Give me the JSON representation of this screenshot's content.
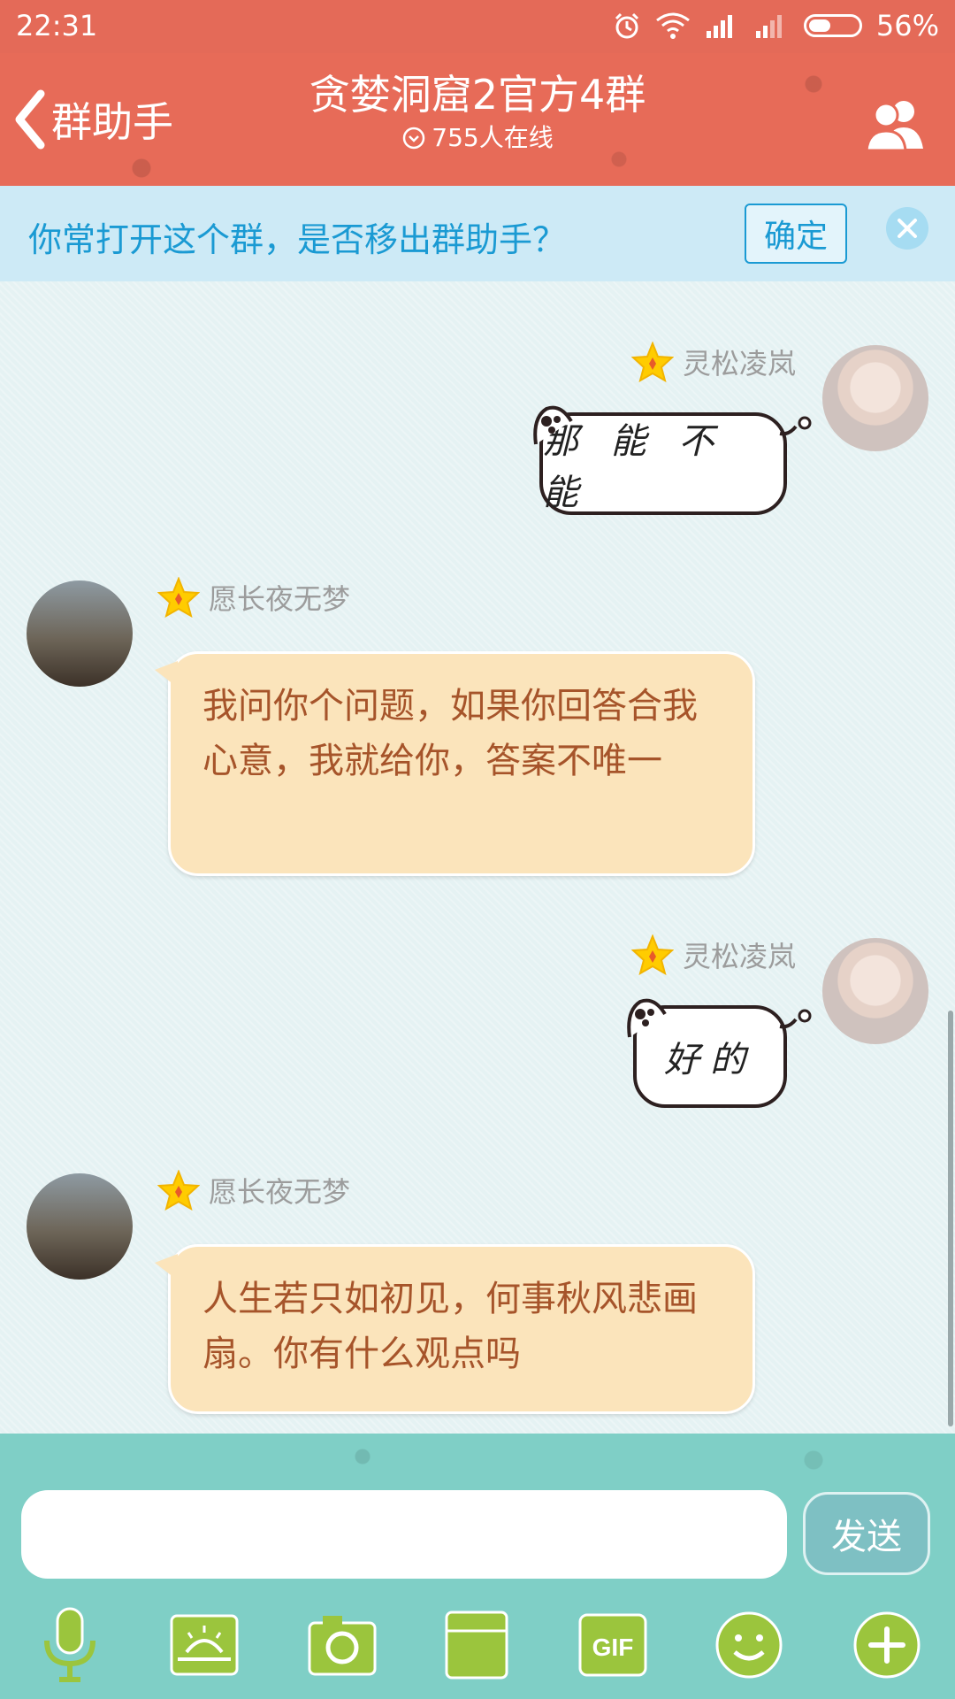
{
  "status_bar": {
    "time": "22:31",
    "battery": "56%"
  },
  "header": {
    "back_label": "群助手",
    "title": "贪婪洞窟2官方4群",
    "online": "755人在线"
  },
  "notice": {
    "text": "你常打开这个群，是否移出群助手？",
    "confirm_label": "确定"
  },
  "messages": [
    {
      "sender": "灵松凌岚",
      "side": "right",
      "type": "ghost",
      "text": "那 能 不 能"
    },
    {
      "sender": "愿长夜无梦",
      "side": "left",
      "type": "text",
      "text": "我问你个问题，如果你回答合我心意，我就给你，答案不唯一"
    },
    {
      "sender": "灵松凌岚",
      "side": "right",
      "type": "ghost",
      "text": "好的"
    },
    {
      "sender": "愿长夜无梦",
      "side": "left",
      "type": "text",
      "text": "人生若只如初见，何事秋风悲画扇。你有什么观点吗"
    }
  ],
  "composer": {
    "input_value": "",
    "send_label": "发送",
    "tools": [
      "microphone-icon",
      "sunrise-image-icon",
      "camera-icon",
      "folder-icon",
      "gif-icon",
      "emoji-icon",
      "plus-icon"
    ],
    "gif_label": "GIF"
  },
  "colors": {
    "header": "#e76b58",
    "notice_bg": "#cdeaf6",
    "notice_text": "#1a9ad3",
    "bubble_warm": "#fbe4bb",
    "bubble_text": "#a6542a",
    "composer": "#7fcfc6",
    "tool_green": "#9bc53d"
  }
}
